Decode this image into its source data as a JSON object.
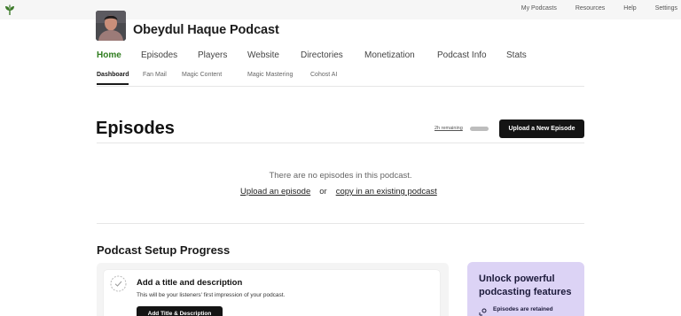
{
  "topnav": {
    "items": [
      "My Podcasts",
      "Resources",
      "Help",
      "Settings"
    ]
  },
  "podcast": {
    "title": "Obeydul Haque Podcast"
  },
  "mainnav": {
    "items": [
      "Home",
      "Episodes",
      "Players",
      "Website",
      "Directories",
      "Monetization",
      "Podcast Info",
      "Stats"
    ],
    "active": "Home"
  },
  "subnav": {
    "items": [
      "Dashboard",
      "Fan Mail",
      "Magic Content",
      "Magic Mastering",
      "Cohost AI"
    ],
    "active": "Dashboard"
  },
  "episodes": {
    "heading": "Episodes",
    "remaining_label": "2h remaining",
    "remaining_fraction": 1.0,
    "upload_label": "Upload a New Episode",
    "empty_text": "There are no episodes in this podcast.",
    "upload_link": "Upload an episode",
    "or_text": "or",
    "copy_link": "copy in an existing podcast"
  },
  "setup": {
    "heading": "Podcast Setup Progress",
    "step_title": "Add a title and description",
    "step_desc": "This will be your listeners' first impression of your podcast.",
    "step_button": "Add Title & Description"
  },
  "promo": {
    "title": "Unlock powerful podcasting features",
    "feature": "Episodes are retained"
  },
  "colors": {
    "accent_green": "#2f7d1e",
    "button_dark": "#141414",
    "promo_bg": "#dcd3f5"
  }
}
